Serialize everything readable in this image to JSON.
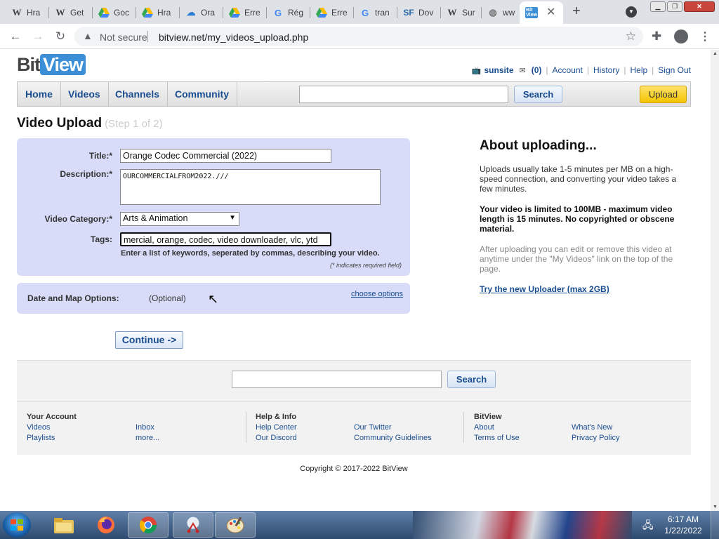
{
  "browser": {
    "tabs": [
      {
        "label": "Hra",
        "icon": "wikipedia-icon"
      },
      {
        "label": "Get",
        "icon": "wikipedia-icon"
      },
      {
        "label": "Goc",
        "icon": "google-drive-icon"
      },
      {
        "label": "Hra",
        "icon": "google-drive-icon"
      },
      {
        "label": "Ora",
        "icon": "cloud-icon"
      },
      {
        "label": "Erre",
        "icon": "google-drive-icon"
      },
      {
        "label": "Rég",
        "icon": "google-icon"
      },
      {
        "label": "Erre",
        "icon": "google-drive-icon"
      },
      {
        "label": "tran",
        "icon": "google-icon"
      },
      {
        "label": "Dov",
        "icon": "sourceforge-icon"
      },
      {
        "label": "Sur",
        "icon": "wikipedia-icon"
      },
      {
        "label": "ww",
        "icon": "globe-icon"
      },
      {
        "label": "",
        "icon": "bitview-icon"
      }
    ],
    "url": "bitview.net/my_videos_upload.php",
    "security": "Not secure"
  },
  "site": {
    "logo": {
      "bit": "Bit",
      "view": "View"
    },
    "userbar": {
      "username": "sunsite",
      "messages": "(0)",
      "links": [
        "Account",
        "History",
        "Help",
        "Sign Out"
      ]
    },
    "nav": {
      "items": [
        "Home",
        "Videos",
        "Channels",
        "Community"
      ],
      "search_button": "Search",
      "upload_button": "Upload"
    }
  },
  "upload": {
    "heading": "Video Upload",
    "step": "(Step 1 of 2)",
    "title_label": "Title:*",
    "title_value": "Orange Codec Commercial (2022)",
    "description_label": "Description:*",
    "description_value": "OURCOMMERCIALFROM2022.///",
    "category_label": "Video Category:*",
    "category_value": "Arts & Animation",
    "tags_label": "Tags:",
    "tags_value": "mercial, orange, codec, video downloader, vlc, ytd",
    "tags_hint": "Enter a list of keywords, seperated by commas, describing your video.",
    "required_note": "(* indicates required field)",
    "date_label": "Date and Map Options:",
    "date_optional": "(Optional)",
    "date_link": "choose options",
    "continue_button": "Continue ->"
  },
  "about": {
    "title": "About uploading...",
    "p1": "Uploads usually take 1-5 minutes per MB on a high-speed connection, and converting your video takes a few minutes.",
    "p2": "Your video is limited to 100MB - maximum video length is 15 minutes. No copyrighted or obscene material.",
    "p3": "After uploading you can edit or remove this video at anytime under the \"My Videos\" link on the top of the page.",
    "link": "Try the new Uploader (max 2GB)"
  },
  "footer": {
    "search_button": "Search",
    "col1_title": "Your Account",
    "col1_links": [
      "Videos",
      "Playlists",
      "Inbox",
      "more..."
    ],
    "col2_title": "Help & Info",
    "col2_links": [
      "Help Center",
      "Our Discord",
      "Our Twitter",
      "Community Guidelines"
    ],
    "col3_title": "BitView",
    "col3_links": [
      "About",
      "Terms of Use",
      "What's New",
      "Privacy Policy"
    ],
    "copyright": "Copyright © 2017-2022 BitView"
  },
  "taskbar": {
    "time": "6:17 AM",
    "date": "1/22/2022"
  }
}
